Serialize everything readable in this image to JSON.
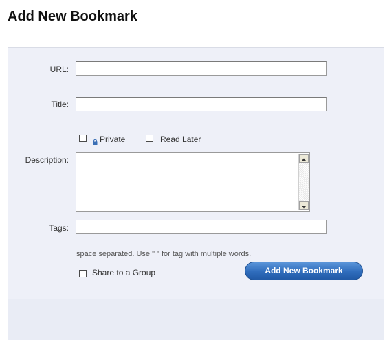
{
  "page": {
    "title": "Add New Bookmark"
  },
  "form": {
    "url": {
      "label": "URL:",
      "value": "",
      "placeholder": ""
    },
    "title": {
      "label": "Title:",
      "value": "",
      "placeholder": ""
    },
    "private": {
      "label": "Private",
      "checked": false,
      "icon": "lock-icon"
    },
    "read_later": {
      "label": "Read Later",
      "checked": false
    },
    "description": {
      "label": "Description:",
      "value": ""
    },
    "tags": {
      "label": "Tags:",
      "value": "",
      "hint": "space separated. Use \" \" for tag with multiple words."
    },
    "share": {
      "label": "Share to a Group",
      "checked": false
    },
    "submit_label": "Add New Bookmark"
  },
  "colors": {
    "panel_bg": "#eef0f8",
    "button_blue": "#2f6cbc",
    "lock_blue": "#3a6fb5"
  }
}
